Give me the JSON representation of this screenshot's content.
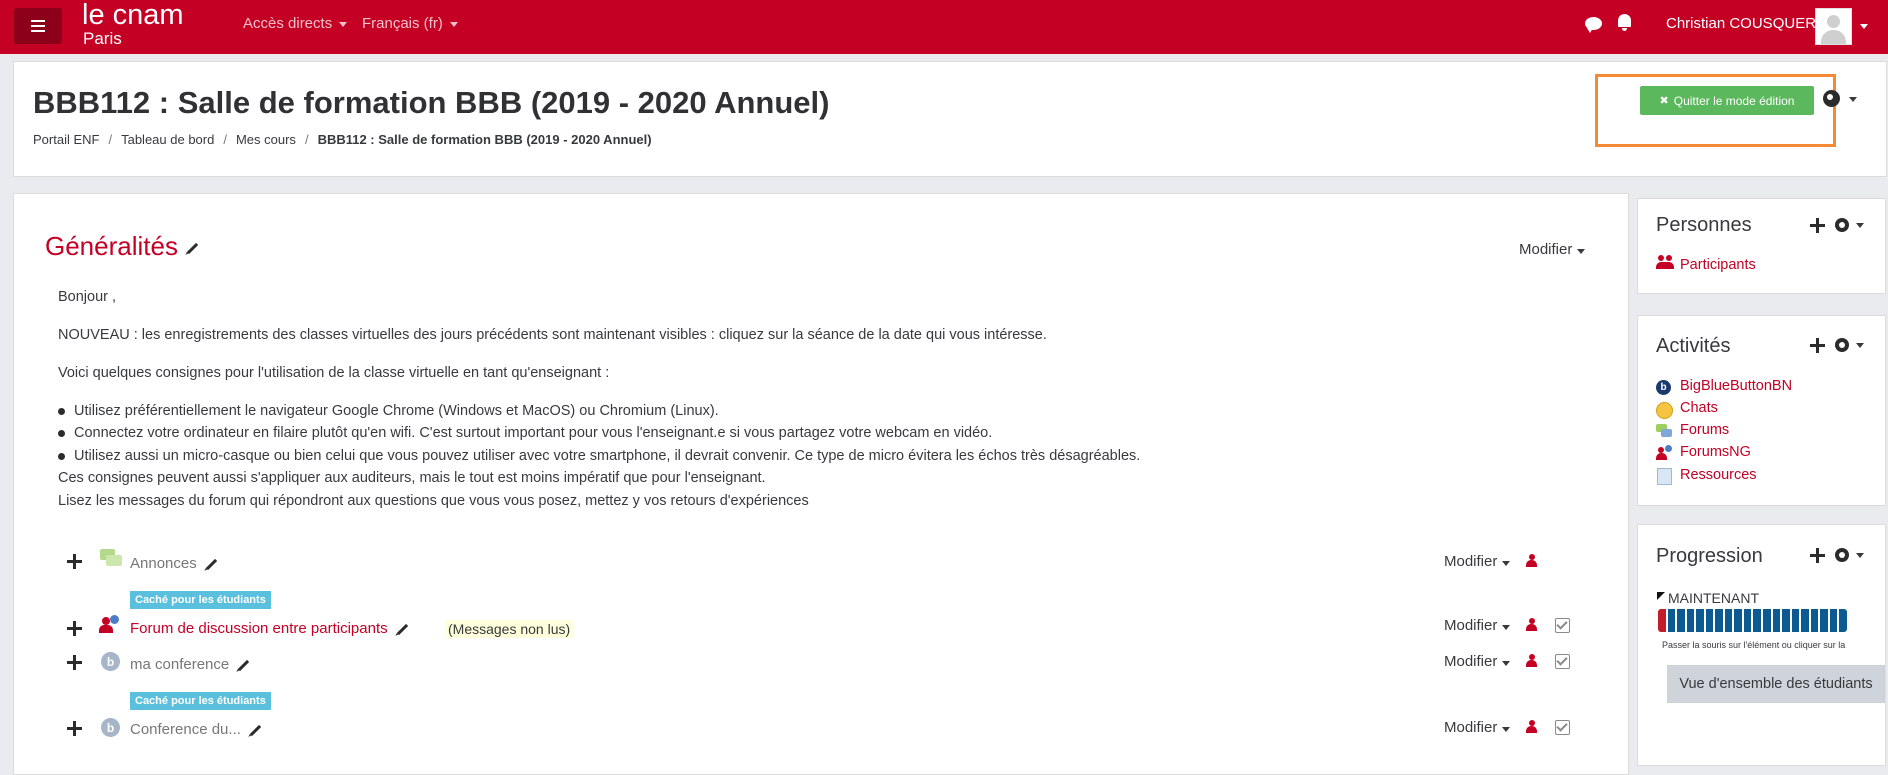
{
  "nav": {
    "brand_top": "le cnam",
    "brand_sub": "Paris",
    "links": [
      "Accès directs",
      "Français (fr)"
    ],
    "user": "Christian COUSQUER"
  },
  "header": {
    "title": "BBB112 : Salle de formation BBB (2019 - 2020 Annuel)",
    "breadcrumb": [
      "Portail ENF",
      "Tableau de bord",
      "Mes cours",
      "BBB112 : Salle de formation BBB (2019 - 2020 Annuel)"
    ],
    "edit_button": "Quitter le mode édition"
  },
  "section": {
    "title": "Généralités",
    "modifier": "Modifier",
    "summary": {
      "greeting": "Bonjour ,",
      "news": "NOUVEAU : les enregistrements des classes virtuelles des jours précédents sont maintenant visibles : cliquez sur la séance de la date qui vous intéresse.",
      "intro": "Voici quelques consignes pour l'utilisation de la classe virtuelle en tant qu'enseignant :",
      "bullets": [
        "Utilisez préférentiellement le navigateur Google Chrome (Windows et MacOS) ou Chromium (Linux).",
        "Connectez votre ordinateur en filaire plutôt qu'en wifi. C'est surtout important pour vous l'enseignant.e si vous partagez votre webcam en vidéo.",
        "Utilisez aussi un micro-casque ou bien celui que vous pouvez utiliser avec votre smartphone, il devrait convenir. Ce type de micro évitera les échos très désagréables."
      ],
      "note1": "Ces consignes peuvent aussi s'appliquer aux auditeurs, mais le tout est moins impératif que pour l'enseignant.",
      "note2": "Lisez les messages du forum qui répondront aux questions que vous vous posez, mettez y vos retours d'expériences"
    },
    "activities": [
      {
        "name": "Annonces",
        "badge": "Caché pour les étudiants",
        "modifier": "Modifier"
      },
      {
        "name": "Forum de discussion entre participants",
        "unread": "(Messages non lus)",
        "modifier": "Modifier"
      },
      {
        "name": "ma conference",
        "badge": "Caché pour les étudiants",
        "modifier": "Modifier"
      },
      {
        "name": "Conference du...",
        "modifier": "Modifier"
      }
    ]
  },
  "blocks": {
    "persons": {
      "title": "Personnes",
      "link": "Participants"
    },
    "activities": {
      "title": "Activités",
      "links": [
        "BigBlueButtonBN",
        "Chats",
        "Forums",
        "ForumsNG",
        "Ressources"
      ]
    },
    "progress": {
      "title": "Progression",
      "now_label": "MAINTENANT",
      "completed_fraction": 0.05,
      "hint": "Passer la souris sur l'élément ou cliquer sur la",
      "overview_button": "Vue d'ensemble des étudiants"
    }
  }
}
